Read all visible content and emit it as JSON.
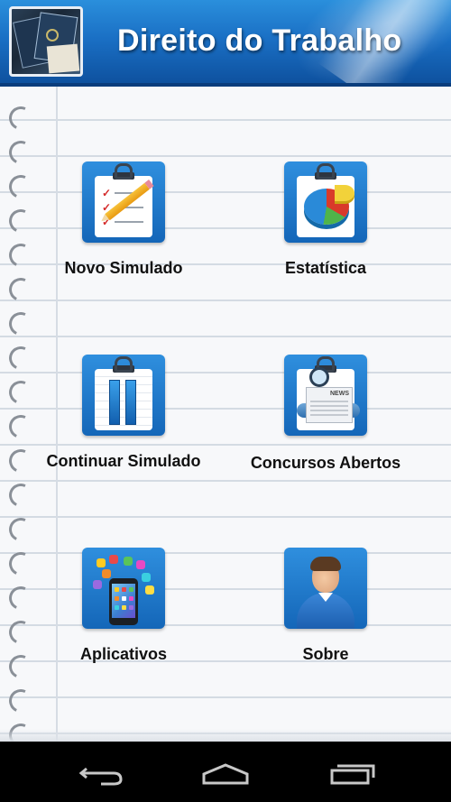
{
  "app": {
    "title": "Direito do Trabalho",
    "accent_color": "#1a6fc4",
    "logo_icon": "work-permit-documents-icon"
  },
  "menu": {
    "items": [
      {
        "label": "Novo Simulado",
        "icon": "clipboard-checklist-pencil-icon"
      },
      {
        "label": "Estatística",
        "icon": "pie-chart-icon"
      },
      {
        "label": "Continuar Simulado",
        "icon": "bar-chart-clipboard-icon"
      },
      {
        "label": "Concursos Abertos",
        "icon": "newspaper-magnifier-icon"
      },
      {
        "label": "Aplicativos",
        "icon": "smartphone-apps-icon"
      },
      {
        "label": "Sobre",
        "icon": "person-avatar-icon"
      }
    ]
  },
  "system_nav": {
    "buttons": [
      "back-icon",
      "home-icon",
      "recent-apps-icon"
    ],
    "icon_color": "#c8c8c8"
  }
}
